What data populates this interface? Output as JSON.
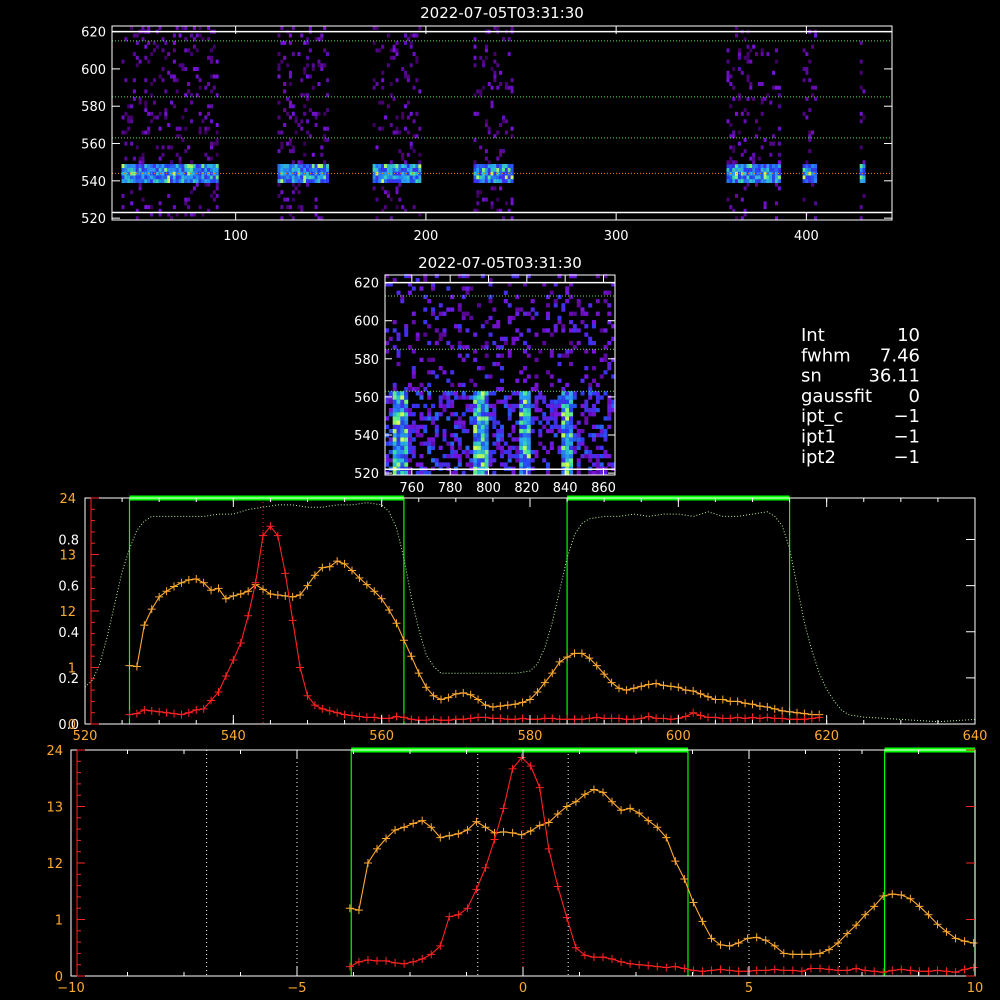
{
  "colors": {
    "background": "#000000",
    "axis": "#ffffff",
    "orange": "#ffaa33",
    "red": "#ff2222",
    "green": "#00ff00",
    "green_dotted": "#b8f5a0",
    "gridline_orange": "#ff8800",
    "gridline_green": "#66dd66"
  },
  "chart_data": [
    {
      "name": "top-image",
      "type": "heatmap",
      "title": "2022-07-05T03:31:30",
      "xlim": [
        35,
        445
      ],
      "ylim": [
        519,
        623
      ],
      "xticks": [
        100,
        200,
        300,
        400
      ],
      "yticks": [
        520,
        540,
        560,
        580,
        600,
        620
      ],
      "column_bands": [
        [
          40,
          90
        ],
        [
          122,
          148
        ],
        [
          172,
          196
        ],
        [
          225,
          245
        ],
        [
          358,
          385
        ],
        [
          398,
          405
        ],
        [
          428,
          430
        ]
      ],
      "line_center_y": 543,
      "orange_dotted_y": [
        544
      ],
      "green_dotted_y": [
        563,
        585,
        615
      ],
      "white_lines_y": [
        523,
        620
      ]
    },
    {
      "name": "middle-image",
      "type": "heatmap",
      "title": "2022-07-05T03:31:30",
      "xlim": [
        746,
        866
      ],
      "ylim": [
        519,
        624
      ],
      "xticks": [
        760,
        780,
        800,
        820,
        840,
        860
      ],
      "yticks": [
        520,
        540,
        560,
        580,
        600,
        620
      ],
      "bright_columns_x": [
        753,
        795,
        818,
        840
      ],
      "green_dotted_y": [
        563,
        585,
        613
      ],
      "white_lines_y": [
        522,
        620
      ]
    },
    {
      "name": "info-panel",
      "type": "table",
      "rows": [
        {
          "label": "Int",
          "value": "10"
        },
        {
          "label": "fwhm",
          "value": "7.46"
        },
        {
          "label": "sn",
          "value": "36.11"
        },
        {
          "label": "gaussfit",
          "value": "0"
        },
        {
          "label": "ipt_c",
          "value": "−1"
        },
        {
          "label": "ipt1",
          "value": "−1"
        },
        {
          "label": "ipt2",
          "value": "−1"
        }
      ]
    },
    {
      "name": "profile-wavelength",
      "type": "line",
      "xlim": [
        520,
        640
      ],
      "xticks": [
        520,
        540,
        560,
        580,
        600,
        620,
        640
      ],
      "ylim_left": [
        0,
        0.98
      ],
      "yticks_left": [
        0.0,
        0.2,
        0.4,
        0.6,
        0.8
      ],
      "yticks_left_labels": [
        "0.0",
        "0.2",
        "0.4",
        "0.6",
        "0.8"
      ],
      "ylim_right": [
        0,
        24
      ],
      "yticks_right_labels": [
        "0",
        "1",
        "12",
        "13",
        "24"
      ],
      "yticks_right_values": [
        0,
        6,
        12,
        18,
        24
      ],
      "green_windows": [
        [
          526,
          563
        ],
        [
          585,
          615
        ]
      ],
      "red_dotted_x": [
        544
      ],
      "series": [
        {
          "color": "orange",
          "axis": "right",
          "x": [
            526,
            527,
            528,
            529,
            530,
            531,
            532,
            533,
            534,
            535,
            536,
            537,
            538,
            539,
            540,
            541,
            542,
            543,
            544,
            545,
            546,
            547,
            548,
            549,
            550,
            551,
            552,
            553,
            554,
            555,
            556,
            557,
            558,
            559,
            560,
            561,
            562,
            563,
            564,
            565,
            566,
            567,
            568,
            569,
            570,
            571,
            572,
            573,
            574,
            575,
            576,
            577,
            578,
            579,
            580,
            581,
            582,
            583,
            584,
            585,
            586,
            587,
            588,
            589,
            590,
            591,
            592,
            593,
            594,
            595,
            596,
            597,
            598,
            599,
            600,
            601,
            602,
            603,
            604,
            605,
            606,
            607,
            608,
            609,
            610,
            611,
            612,
            613,
            614,
            615,
            616,
            617,
            618,
            619
          ],
          "y": [
            6.2,
            6.1,
            10.5,
            12.2,
            13.5,
            14.1,
            14.6,
            15.0,
            15.3,
            15.4,
            15.0,
            14.2,
            14.4,
            13.3,
            13.6,
            13.8,
            14.1,
            14.8,
            14.3,
            13.8,
            13.7,
            13.6,
            13.5,
            13.7,
            14.7,
            15.8,
            16.6,
            16.7,
            17.3,
            17.0,
            16.3,
            15.5,
            14.8,
            14.1,
            13.3,
            12.1,
            10.7,
            8.9,
            7.2,
            5.4,
            3.9,
            3.0,
            2.6,
            2.8,
            3.2,
            3.3,
            3.1,
            2.6,
            2.0,
            1.8,
            1.9,
            2.0,
            2.1,
            2.3,
            2.6,
            3.4,
            4.4,
            5.4,
            6.6,
            7.1,
            7.5,
            7.5,
            7.0,
            6.2,
            5.3,
            4.4,
            3.8,
            3.6,
            3.8,
            4.0,
            4.2,
            4.3,
            4.1,
            4.0,
            3.9,
            3.6,
            3.5,
            3.2,
            2.9,
            2.6,
            2.6,
            2.4,
            2.4,
            2.2,
            2.1,
            1.9,
            1.8,
            1.6,
            1.4,
            1.3,
            1.2,
            1.1,
            1.0,
            1.0
          ]
        },
        {
          "color": "red",
          "axis": "right",
          "x": [
            526,
            527,
            528,
            529,
            530,
            531,
            532,
            533,
            534,
            535,
            536,
            537,
            538,
            539,
            540,
            541,
            542,
            543,
            544,
            545,
            546,
            547,
            548,
            549,
            550,
            551,
            552,
            553,
            554,
            555,
            556,
            557,
            558,
            559,
            560,
            561,
            562,
            563,
            564,
            565,
            566,
            567,
            568,
            569,
            570,
            571,
            572,
            573,
            574,
            575,
            576,
            577,
            578,
            579,
            580,
            581,
            582,
            583,
            584,
            585,
            586,
            587,
            588,
            589,
            590,
            591,
            592,
            593,
            594,
            595,
            596,
            597,
            598,
            599,
            600,
            601,
            602,
            603,
            604,
            605,
            606,
            607,
            608,
            609,
            610,
            611,
            612,
            613,
            614,
            615,
            616,
            617,
            618,
            619
          ],
          "y": [
            1.0,
            1.1,
            1.5,
            1.4,
            1.3,
            1.2,
            1.1,
            1.0,
            1.2,
            1.5,
            1.6,
            2.5,
            3.4,
            5.1,
            6.8,
            8.6,
            11.5,
            15.0,
            20.0,
            21.0,
            20.0,
            16.0,
            11.0,
            6.0,
            3.0,
            2.0,
            1.6,
            1.4,
            1.2,
            1.0,
            0.9,
            0.8,
            0.7,
            0.7,
            0.6,
            0.6,
            0.8,
            0.7,
            0.5,
            0.4,
            0.4,
            0.5,
            0.4,
            0.4,
            0.5,
            0.5,
            0.6,
            0.7,
            0.7,
            0.6,
            0.6,
            0.5,
            0.5,
            0.6,
            0.5,
            0.5,
            0.6,
            0.6,
            0.5,
            0.5,
            0.5,
            0.5,
            0.6,
            0.7,
            0.6,
            0.6,
            0.6,
            0.5,
            0.5,
            0.6,
            0.8,
            0.6,
            0.6,
            0.5,
            0.6,
            0.8,
            1.2,
            0.9,
            0.7,
            0.7,
            0.6,
            0.6,
            0.7,
            0.6,
            0.7,
            0.6,
            0.7,
            0.6,
            0.6,
            0.5,
            0.5,
            0.5,
            0.6,
            0.7
          ]
        },
        {
          "color": "green_dotted",
          "axis": "left",
          "style": "dotted",
          "x": [
            520,
            521,
            522,
            523,
            524,
            525,
            526,
            527,
            528,
            529,
            530,
            532,
            534,
            536,
            538,
            540,
            542,
            544,
            546,
            548,
            550,
            552,
            554,
            556,
            558,
            560,
            561,
            562,
            563,
            564,
            565,
            566,
            567,
            568,
            569,
            570,
            572,
            575,
            578,
            580,
            581,
            582,
            583,
            584,
            585,
            586,
            587,
            588,
            590,
            592,
            594,
            596,
            598,
            600,
            602,
            604,
            606,
            608,
            610,
            612,
            613,
            614,
            615,
            616,
            617,
            618,
            619,
            620,
            621,
            622,
            623,
            625,
            630,
            635,
            640
          ],
          "y": [
            0.16,
            0.19,
            0.26,
            0.38,
            0.52,
            0.66,
            0.76,
            0.84,
            0.88,
            0.9,
            0.9,
            0.9,
            0.9,
            0.9,
            0.91,
            0.91,
            0.93,
            0.94,
            0.95,
            0.95,
            0.94,
            0.94,
            0.95,
            0.95,
            0.96,
            0.95,
            0.92,
            0.85,
            0.72,
            0.55,
            0.41,
            0.3,
            0.25,
            0.22,
            0.22,
            0.22,
            0.22,
            0.22,
            0.22,
            0.23,
            0.26,
            0.33,
            0.44,
            0.58,
            0.72,
            0.82,
            0.87,
            0.89,
            0.9,
            0.9,
            0.91,
            0.9,
            0.91,
            0.91,
            0.9,
            0.92,
            0.9,
            0.9,
            0.91,
            0.92,
            0.9,
            0.86,
            0.76,
            0.6,
            0.44,
            0.32,
            0.22,
            0.15,
            0.1,
            0.06,
            0.04,
            0.03,
            0.02,
            0.01,
            0.02
          ]
        }
      ]
    },
    {
      "name": "profile-offset",
      "type": "line",
      "xlim": [
        -10,
        10
      ],
      "xticks": [
        -10,
        -5,
        0,
        5,
        10
      ],
      "xticks_labels": [
        "−10",
        "−5",
        "0",
        "5",
        "10"
      ],
      "ylim": [
        0,
        24
      ],
      "yticks_labels": [
        "0",
        "1",
        "12",
        "13",
        "24"
      ],
      "yticks_values": [
        0,
        6,
        12,
        18,
        24
      ],
      "green_windows": [
        [
          -3.8,
          3.65
        ],
        [
          8.0,
          10.0
        ]
      ],
      "white_dotted_x": [
        -7,
        -5,
        -1,
        1,
        5,
        7
      ],
      "red_dotted_x": [
        0
      ],
      "series": [
        {
          "color": "orange",
          "x": [
            -3.83,
            -3.63,
            -3.43,
            -3.23,
            -3.03,
            -2.83,
            -2.63,
            -2.43,
            -2.23,
            -2.03,
            -1.83,
            -1.63,
            -1.43,
            -1.23,
            -1.03,
            -0.83,
            -0.63,
            -0.43,
            -0.23,
            -0.03,
            0.17,
            0.37,
            0.57,
            0.77,
            0.97,
            1.17,
            1.37,
            1.57,
            1.77,
            1.97,
            2.17,
            2.37,
            2.57,
            2.77,
            2.97,
            3.17,
            3.37,
            3.57,
            3.77,
            3.97,
            4.17,
            4.37,
            4.57,
            4.77,
            4.97,
            5.17,
            5.37,
            5.57,
            5.77,
            5.97,
            6.17,
            6.37,
            6.57,
            6.77,
            6.97,
            7.17,
            7.37,
            7.57,
            7.77,
            7.97,
            8.17,
            8.37,
            8.57,
            8.77,
            8.97,
            9.17,
            9.37,
            9.57,
            9.77,
            9.97
          ],
          "y": [
            7.2,
            7.0,
            12.0,
            13.5,
            14.6,
            15.5,
            15.8,
            16.2,
            16.5,
            15.8,
            14.7,
            14.9,
            15.1,
            15.5,
            16.4,
            15.8,
            15.2,
            15.3,
            15.2,
            15.0,
            15.4,
            16.0,
            16.3,
            17.2,
            18.0,
            18.5,
            19.3,
            19.8,
            19.5,
            18.5,
            17.6,
            17.8,
            17.3,
            16.5,
            15.8,
            14.7,
            12.2,
            10.3,
            7.8,
            5.8,
            4.0,
            3.3,
            3.2,
            3.5,
            4.0,
            4.1,
            3.8,
            3.2,
            2.4,
            2.3,
            2.3,
            2.3,
            2.4,
            2.8,
            3.5,
            4.5,
            5.4,
            6.5,
            7.4,
            8.5,
            8.7,
            8.6,
            8.2,
            7.4,
            6.5,
            5.5,
            4.7,
            4.0,
            3.7,
            3.5
          ]
        },
        {
          "color": "red",
          "x": [
            -3.83,
            -3.63,
            -3.43,
            -3.23,
            -3.03,
            -2.83,
            -2.63,
            -2.43,
            -2.23,
            -2.03,
            -1.83,
            -1.63,
            -1.43,
            -1.23,
            -1.03,
            -0.83,
            -0.63,
            -0.43,
            -0.23,
            -0.03,
            0.17,
            0.37,
            0.57,
            0.77,
            0.97,
            1.17,
            1.37,
            1.57,
            1.77,
            1.97,
            2.17,
            2.37,
            2.57,
            2.77,
            2.97,
            3.17,
            3.37,
            3.57,
            3.77,
            3.97,
            4.17,
            4.37,
            4.57,
            4.77,
            4.97,
            5.17,
            5.37,
            5.57,
            5.77,
            5.97,
            6.17,
            6.37,
            6.57,
            6.77,
            6.97,
            7.17,
            7.37,
            7.57,
            7.77,
            7.97,
            8.17,
            8.37,
            8.57,
            8.77,
            8.97,
            9.17,
            9.37,
            9.57,
            9.77,
            9.97
          ],
          "y": [
            1.0,
            1.5,
            1.7,
            1.6,
            1.6,
            1.4,
            1.3,
            1.5,
            1.8,
            2.3,
            3.2,
            6.3,
            6.5,
            7.2,
            9.2,
            11.5,
            14.5,
            17.8,
            22.0,
            23.2,
            22.3,
            20.0,
            13.5,
            9.5,
            6.2,
            3.0,
            2.2,
            2.0,
            2.0,
            1.8,
            1.5,
            1.3,
            1.2,
            1.1,
            1.0,
            0.9,
            1.0,
            0.8,
            0.6,
            0.5,
            0.6,
            0.7,
            0.6,
            0.5,
            0.5,
            0.6,
            0.6,
            0.7,
            0.6,
            0.6,
            0.5,
            0.8,
            0.8,
            0.7,
            0.6,
            0.6,
            0.8,
            0.6,
            0.5,
            0.4,
            0.6,
            0.7,
            0.6,
            0.5,
            0.5,
            0.6,
            0.5,
            0.4,
            0.7,
            0.9
          ]
        }
      ]
    }
  ]
}
